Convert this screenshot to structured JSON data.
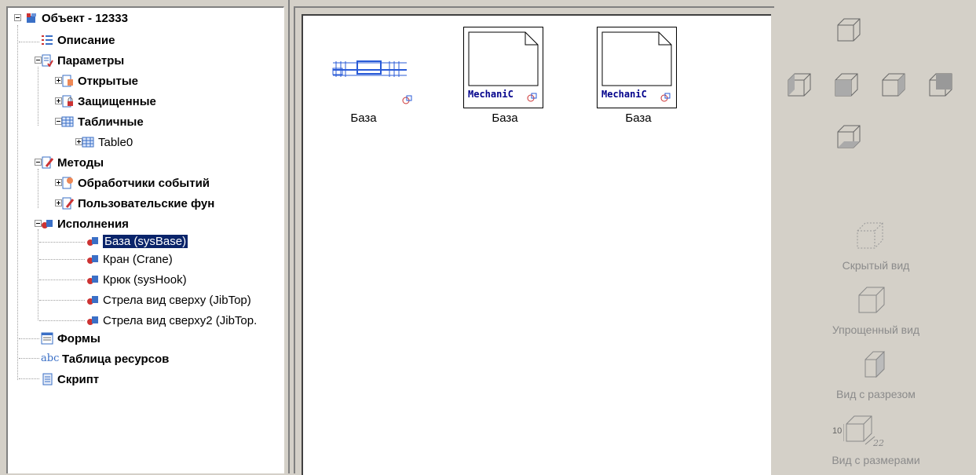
{
  "tree": {
    "root": "Объект - 12333",
    "description": "Описание",
    "parameters": "Параметры",
    "open": "Открытые",
    "protected": "Защищенные",
    "tabular": "Табличные",
    "table0": "Table0",
    "methods": "Методы",
    "event_handlers": "Обработчики событий",
    "user_functions": "Пользовательские фун",
    "executions": "Исполнения",
    "exec_items": [
      "База (sysBase)",
      "Кран (Crane)",
      "Крюк (sysHook)",
      "Стрела вид сверху (JibTop)",
      "Стрела вид сверху2 (JibTop."
    ],
    "forms": "Формы",
    "resource_table": "Таблица ресурсов",
    "script": "Скрипт"
  },
  "view": {
    "thumbs": [
      {
        "caption": "База",
        "text": ""
      },
      {
        "caption": "База",
        "text": "MechaniC"
      },
      {
        "caption": "База",
        "text": "MechaniC"
      }
    ]
  },
  "toolbar": {
    "hidden_view": "Скрытый вид",
    "simplified_view": "Упрощенный вид",
    "section_view": "Вид с разрезом",
    "dimension_view": "Вид с размерами",
    "dim_value": "10"
  },
  "icons": {
    "root": "object-icon",
    "description": "list-icon",
    "params": "params-icon",
    "open": "open-params-icon",
    "protected": "protected-params-icon",
    "table": "table-icon",
    "methods": "methods-icon",
    "exec": "execution-icon",
    "forms": "form-icon",
    "resources": "abc-icon",
    "script": "script-icon"
  }
}
